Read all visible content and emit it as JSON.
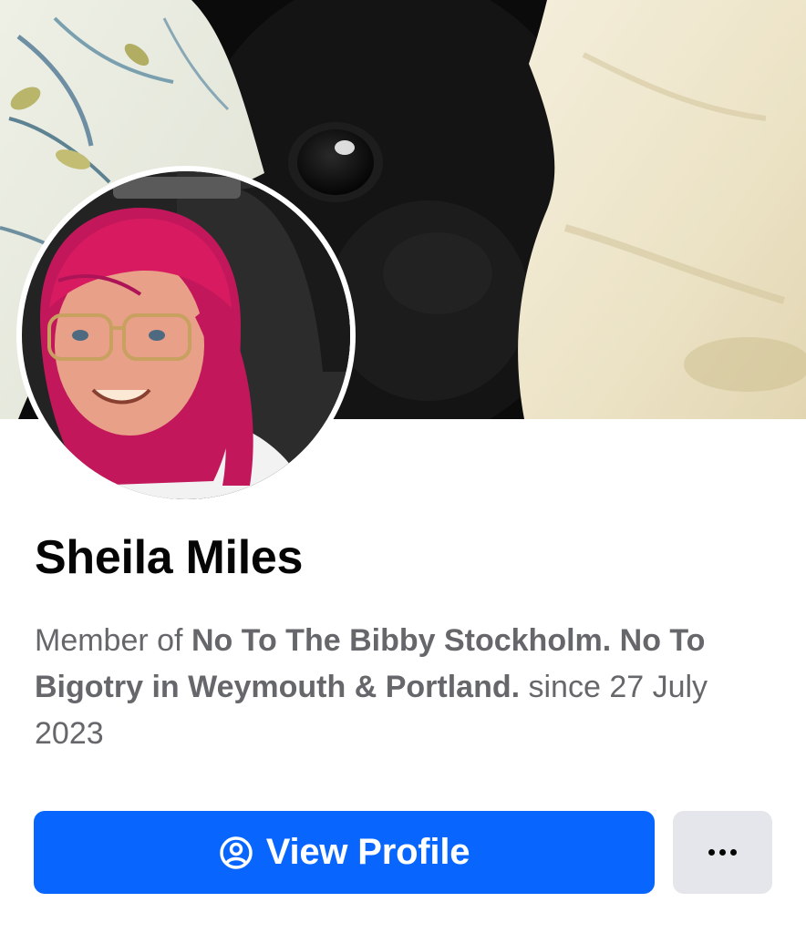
{
  "profile": {
    "cover_description": "cover-photo",
    "avatar_description": "profile-photo",
    "name": "Sheila Miles"
  },
  "membership": {
    "prefix": "Member of",
    "group_name": "No To The Bibby Stockholm. No To Bigotry in Weymouth & Portland.",
    "suffix": "since 27 July 2023"
  },
  "actions": {
    "view_profile_label": "View Profile",
    "view_profile_icon": "user-circle-icon",
    "more_icon": "more-dots-icon"
  },
  "colors": {
    "primary_button": "#0866ff",
    "secondary_button": "#e4e6eb",
    "name_text": "#050505",
    "secondary_text": "#65676b"
  }
}
